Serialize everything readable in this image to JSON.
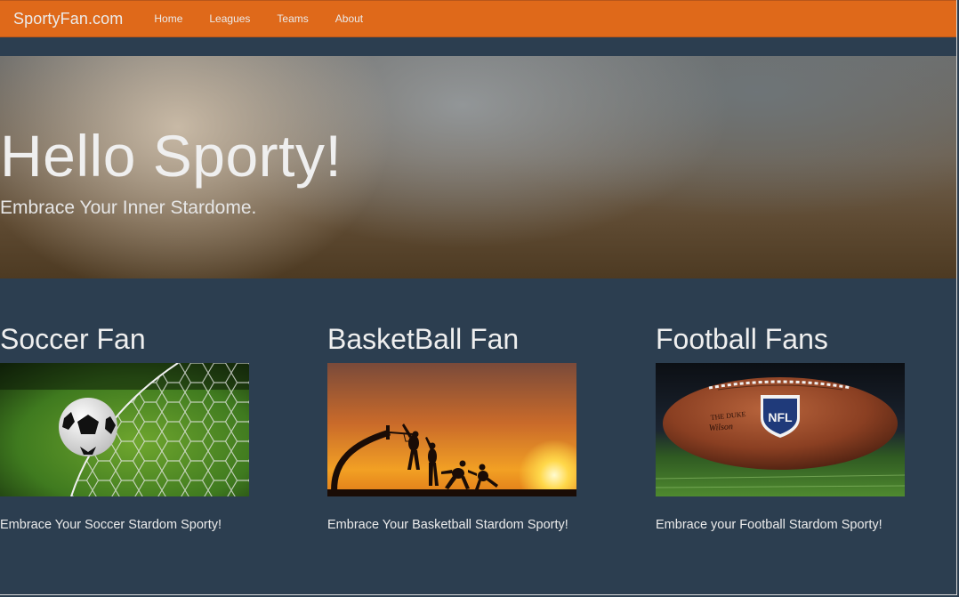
{
  "navbar": {
    "brand": "SportyFan.com",
    "links": [
      "Home",
      "Leagues",
      "Teams",
      "About"
    ]
  },
  "hero": {
    "title": "Hello Sporty!",
    "subtitle": "Embrace Your Inner Stardome."
  },
  "cards": [
    {
      "title": "Soccer Fan",
      "text": "Embrace Your Soccer Stardom Sporty!"
    },
    {
      "title": "BasketBall Fan",
      "text": "Embrace Your Basketball Stardom Sporty!"
    },
    {
      "title": "Football Fans",
      "text": "Embrace your Football Stardom Sporty!"
    }
  ],
  "colors": {
    "navbar": "#df691a",
    "background": "#2c3e50",
    "text": "#ebebeb"
  },
  "ball_logo": {
    "nfl": "NFL",
    "duke": "THE DUKE",
    "wilson": "Wilson"
  }
}
